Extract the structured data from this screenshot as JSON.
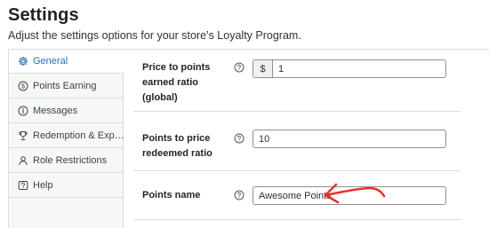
{
  "header": {
    "title": "Settings",
    "subtitle": "Adjust the settings options for your store’s Loyalty Program."
  },
  "sidebar": {
    "items": [
      {
        "label": "General",
        "icon": "gear-icon",
        "active": true
      },
      {
        "label": "Points Earning",
        "icon": "dollar-circle-icon",
        "active": false
      },
      {
        "label": "Messages",
        "icon": "info-circle-icon",
        "active": false
      },
      {
        "label": "Redemption & Exp…",
        "icon": "trophy-icon",
        "active": false
      },
      {
        "label": "Role Restrictions",
        "icon": "user-icon",
        "active": false
      },
      {
        "label": "Help",
        "icon": "help-box-icon",
        "active": false
      }
    ]
  },
  "settings": {
    "price_to_points": {
      "label": "Price to points earned ratio (global)",
      "prefix": "$",
      "value": "1"
    },
    "points_to_price": {
      "label": "Points to price redeemed ratio",
      "value": "10"
    },
    "points_name": {
      "label": "Points name",
      "value": "Awesome Points"
    }
  },
  "colors": {
    "accent": "#2271b1",
    "annotation_arrow": "#e5332a",
    "sidebar_bg": "#f6f7f7",
    "border": "#dcdcde"
  }
}
